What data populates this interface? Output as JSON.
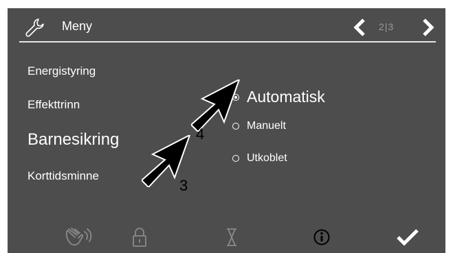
{
  "header": {
    "title": "Meny",
    "page_indicator": "2|3",
    "icons": {
      "menu": "wrench-icon",
      "prev": "chevron-left-icon",
      "next": "chevron-right-icon"
    }
  },
  "menu": {
    "items": [
      {
        "label": "Energistyring"
      },
      {
        "label": "Effekttrinn"
      },
      {
        "label": "Barnesikring",
        "selected": true
      },
      {
        "label": "Korttidsminne"
      }
    ]
  },
  "options": {
    "items": [
      {
        "label": "Automatisk",
        "selected": true
      },
      {
        "label": "Manuelt",
        "selected": false
      },
      {
        "label": "Utkoblet",
        "selected": false
      }
    ]
  },
  "footer": {
    "icons": [
      "hand-wave-icon",
      "lock-icon",
      "hourglass-icon",
      "info-icon",
      "checkmark-icon"
    ]
  },
  "annotations": {
    "callouts": [
      "3",
      "4"
    ]
  },
  "colors": {
    "screen_background": "#4d4d4d",
    "foreground": "#ffffff",
    "inactive_icon": "#8a8a8a",
    "page_indicator": "#9a9a9a",
    "annotation_arrow": "#000000"
  }
}
